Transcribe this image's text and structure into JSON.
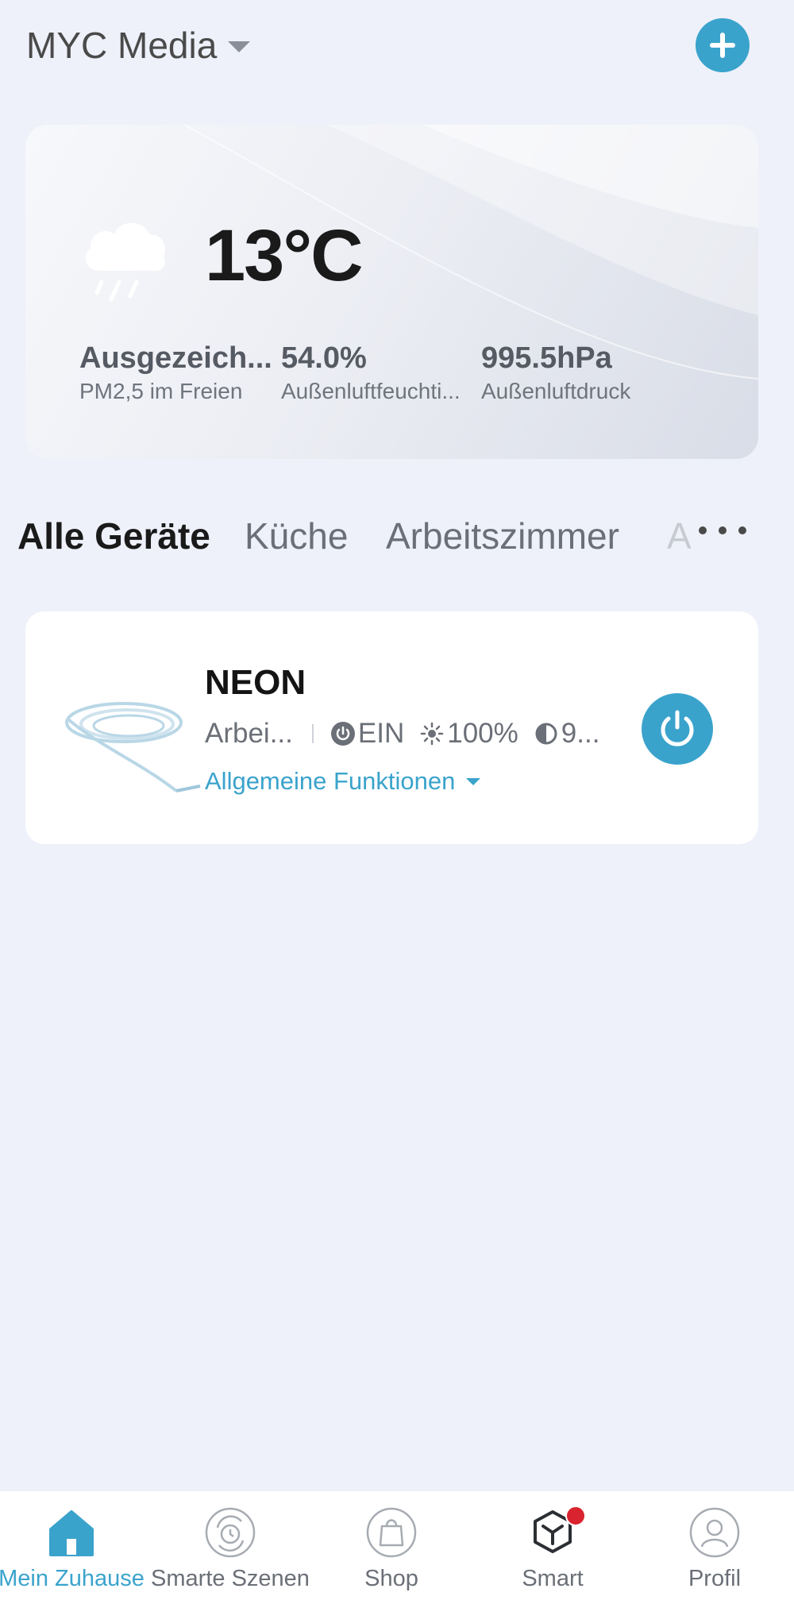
{
  "header": {
    "home_name": "MYC Media"
  },
  "weather": {
    "temperature": "13°C",
    "stats": [
      {
        "value": "Ausgezeich...",
        "label": "PM2,5 im Freien"
      },
      {
        "value": "54.0%",
        "label": "Außenluftfeuchti..."
      },
      {
        "value": "995.5hPa",
        "label": "Außenluftdruck"
      }
    ]
  },
  "tabs": [
    {
      "label": "Alle Geräte",
      "active": true
    },
    {
      "label": "Küche"
    },
    {
      "label": "Arbeitszimmer"
    },
    {
      "label": "A"
    }
  ],
  "device": {
    "name": "NEON",
    "room": "Arbei...",
    "power_state": "EIN",
    "brightness": "100%",
    "contrast": "9...",
    "functions_label": "Allgemeine Funktionen"
  },
  "nav": [
    {
      "label": "Mein Zuhause",
      "icon": "home-icon",
      "active": true
    },
    {
      "label": "Smarte Szenen",
      "icon": "scenes-icon"
    },
    {
      "label": "Shop",
      "icon": "shop-bag-icon"
    },
    {
      "label": "Smart",
      "icon": "smart-cube-icon",
      "badge": true
    },
    {
      "label": "Profil",
      "icon": "profile-icon"
    }
  ],
  "colors": {
    "accent": "#3aa3cc",
    "background": "#eef1fa",
    "badge": "#d9232e"
  }
}
